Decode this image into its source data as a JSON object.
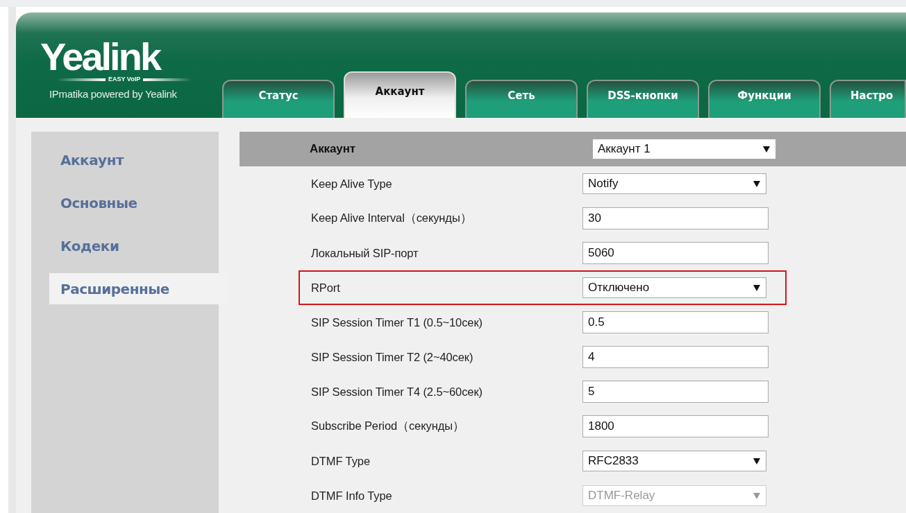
{
  "logo": {
    "brand": "Yealink",
    "tagline": "EASY VoIP",
    "caption": "IPmatika powered by Yealink"
  },
  "tabs": [
    {
      "label": "Статус",
      "selected": false
    },
    {
      "label": "Аккаунт",
      "selected": true
    },
    {
      "label": "Сеть",
      "selected": false
    },
    {
      "label": "DSS-кнопки",
      "selected": false
    },
    {
      "label": "Функции",
      "selected": false
    },
    {
      "label": "Настро",
      "selected": false
    }
  ],
  "sidebar": {
    "items": [
      {
        "label": "Аккаунт",
        "selected": false
      },
      {
        "label": "Основные",
        "selected": false
      },
      {
        "label": "Кодеки",
        "selected": false
      },
      {
        "label": "Расширенные",
        "selected": true
      }
    ]
  },
  "form": {
    "header": {
      "label": "Аккаунт",
      "value": "Аккаунт 1"
    },
    "rows": [
      {
        "label": "Keep Alive Type",
        "kind": "select",
        "value": "Notify",
        "disabled": false,
        "highlighted": false
      },
      {
        "label": "Keep Alive Interval（секунды）",
        "kind": "input",
        "value": "30",
        "disabled": false,
        "highlighted": false
      },
      {
        "label": "Локальный SIP-порт",
        "kind": "input",
        "value": "5060",
        "disabled": false,
        "highlighted": false
      },
      {
        "label": "RPort",
        "kind": "select",
        "value": "Отключено",
        "disabled": false,
        "highlighted": true
      },
      {
        "label": "SIP Session Timer T1 (0.5~10сек)",
        "kind": "input",
        "value": "0.5",
        "disabled": false,
        "highlighted": false
      },
      {
        "label": "SIP Session Timer T2 (2~40сек)",
        "kind": "input",
        "value": "4",
        "disabled": false,
        "highlighted": false
      },
      {
        "label": "SIP Session Timer T4 (2.5~60сек)",
        "kind": "input",
        "value": "5",
        "disabled": false,
        "highlighted": false
      },
      {
        "label": "Subscribe Period（секунды）",
        "kind": "input",
        "value": "1800",
        "disabled": false,
        "highlighted": false
      },
      {
        "label": "DTMF Type",
        "kind": "select",
        "value": "RFC2833",
        "disabled": false,
        "highlighted": false
      },
      {
        "label": "DTMF Info Type",
        "kind": "select",
        "value": "DTMF-Relay",
        "disabled": true,
        "highlighted": false
      }
    ]
  }
}
